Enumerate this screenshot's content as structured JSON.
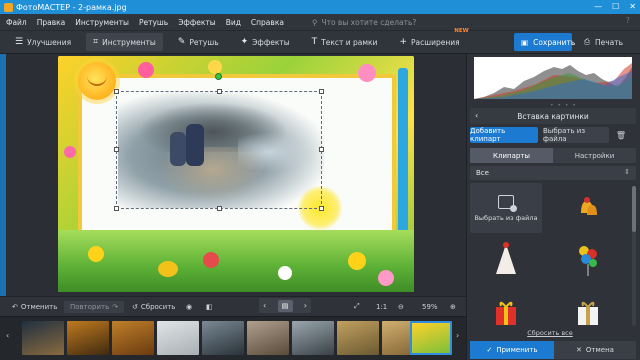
{
  "window": {
    "title": "ФотоМАСТЕР - 2-рамка.jpg",
    "min": "—",
    "max": "☐",
    "close": "✕"
  },
  "menu": {
    "items": [
      "Файл",
      "Правка",
      "Инструменты",
      "Ретушь",
      "Эффекты",
      "Вид",
      "Справка"
    ],
    "search_placeholder": "Что вы хотите сделать?",
    "right_note": "?"
  },
  "toolbar": {
    "tools": [
      {
        "label": "Улучшения",
        "icon": "sliders-icon"
      },
      {
        "label": "Инструменты",
        "icon": "crop-icon",
        "active": true
      },
      {
        "label": "Ретушь",
        "icon": "brush-icon"
      },
      {
        "label": "Эффекты",
        "icon": "wand-icon"
      },
      {
        "label": "Текст и рамки",
        "icon": "text-icon"
      },
      {
        "label": "Расширения",
        "icon": "plus-icon",
        "badge": "NEW"
      }
    ],
    "save_label": "Сохранить",
    "print_label": "Печать"
  },
  "controls": {
    "undo_label": "Отменить",
    "redo_label": "Повторить",
    "reset_label": "Сбросить",
    "ratio_label": "1:1",
    "zoom_value": "59%"
  },
  "right_panel": {
    "section_title": "Вставка картинки",
    "add_clipart_label": "Добавить клипарт",
    "choose_file_label": "Выбрать из файла",
    "tabs": [
      "Клипарты",
      "Настройки"
    ],
    "category_value": "Все",
    "grid_pick_label": "Выбрать из файла",
    "reset_all_label": "Сбросить все",
    "apply_label": "Применить",
    "cancel_label": "Отмена"
  },
  "colors": {
    "accent": "#1d7ad1",
    "titlebar": "#1f8fd8",
    "panel": "#2f3239"
  }
}
